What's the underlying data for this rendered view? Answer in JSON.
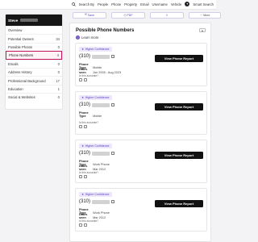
{
  "nav": {
    "items": [
      "Search By",
      "People",
      "Phone",
      "Property",
      "Email",
      "Username",
      "Vehicle"
    ],
    "smart_search": "Smart Search"
  },
  "sidebar": {
    "name": "Steve",
    "items": [
      {
        "label": "Overview",
        "count": ""
      },
      {
        "label": "Potential Owners",
        "count": "34"
      },
      {
        "label": "Possible Photos",
        "count": "0"
      },
      {
        "label": "Phone Numbers",
        "count": "4"
      },
      {
        "label": "Emails",
        "count": "0"
      },
      {
        "label": "Address History",
        "count": "0"
      },
      {
        "label": "Professional Background",
        "count": "17"
      },
      {
        "label": "Education",
        "count": "1"
      },
      {
        "label": "Social & Websites",
        "count": "0"
      }
    ],
    "active_index": 3
  },
  "actions": {
    "save": "Save",
    "pdf": "PDF",
    "share": "",
    "more": "More"
  },
  "main": {
    "title": "Possible Phone Numbers",
    "learn_more": "Learn more",
    "cards": [
      {
        "badge": "Higher Confidence",
        "area": "(310)",
        "type_label": "Phone Type",
        "type": "Mobile",
        "date_label": "Dates seen",
        "dates": "Jun 2005 - Aug 2023",
        "accurate": "Is this accurate?",
        "button": "View Phone Report"
      },
      {
        "badge": "Higher Confidence",
        "area": "(310)",
        "type_label": "Phone Type",
        "type": "Mobile",
        "date_label": "",
        "dates": "",
        "accurate": "Is this accurate?",
        "button": "View Phone Report"
      },
      {
        "badge": "Higher Confidence",
        "area": "(310)",
        "type_label": "Phone Type",
        "type": "Work Phone",
        "date_label": "Dates seen",
        "dates": "Mar 2012",
        "accurate": "Is this accurate?",
        "button": "View Phone Report"
      },
      {
        "badge": "Higher Confidence",
        "area": "(310)",
        "type_label": "Phone Type",
        "type": "Work Phone",
        "date_label": "Dates seen",
        "dates": "Mar 2012",
        "accurate": "Is this accurate?",
        "button": "View Phone Report"
      }
    ]
  },
  "colors": {
    "accent": "#5a3fb5",
    "active_border": "#c2185b",
    "dark": "#111111"
  }
}
